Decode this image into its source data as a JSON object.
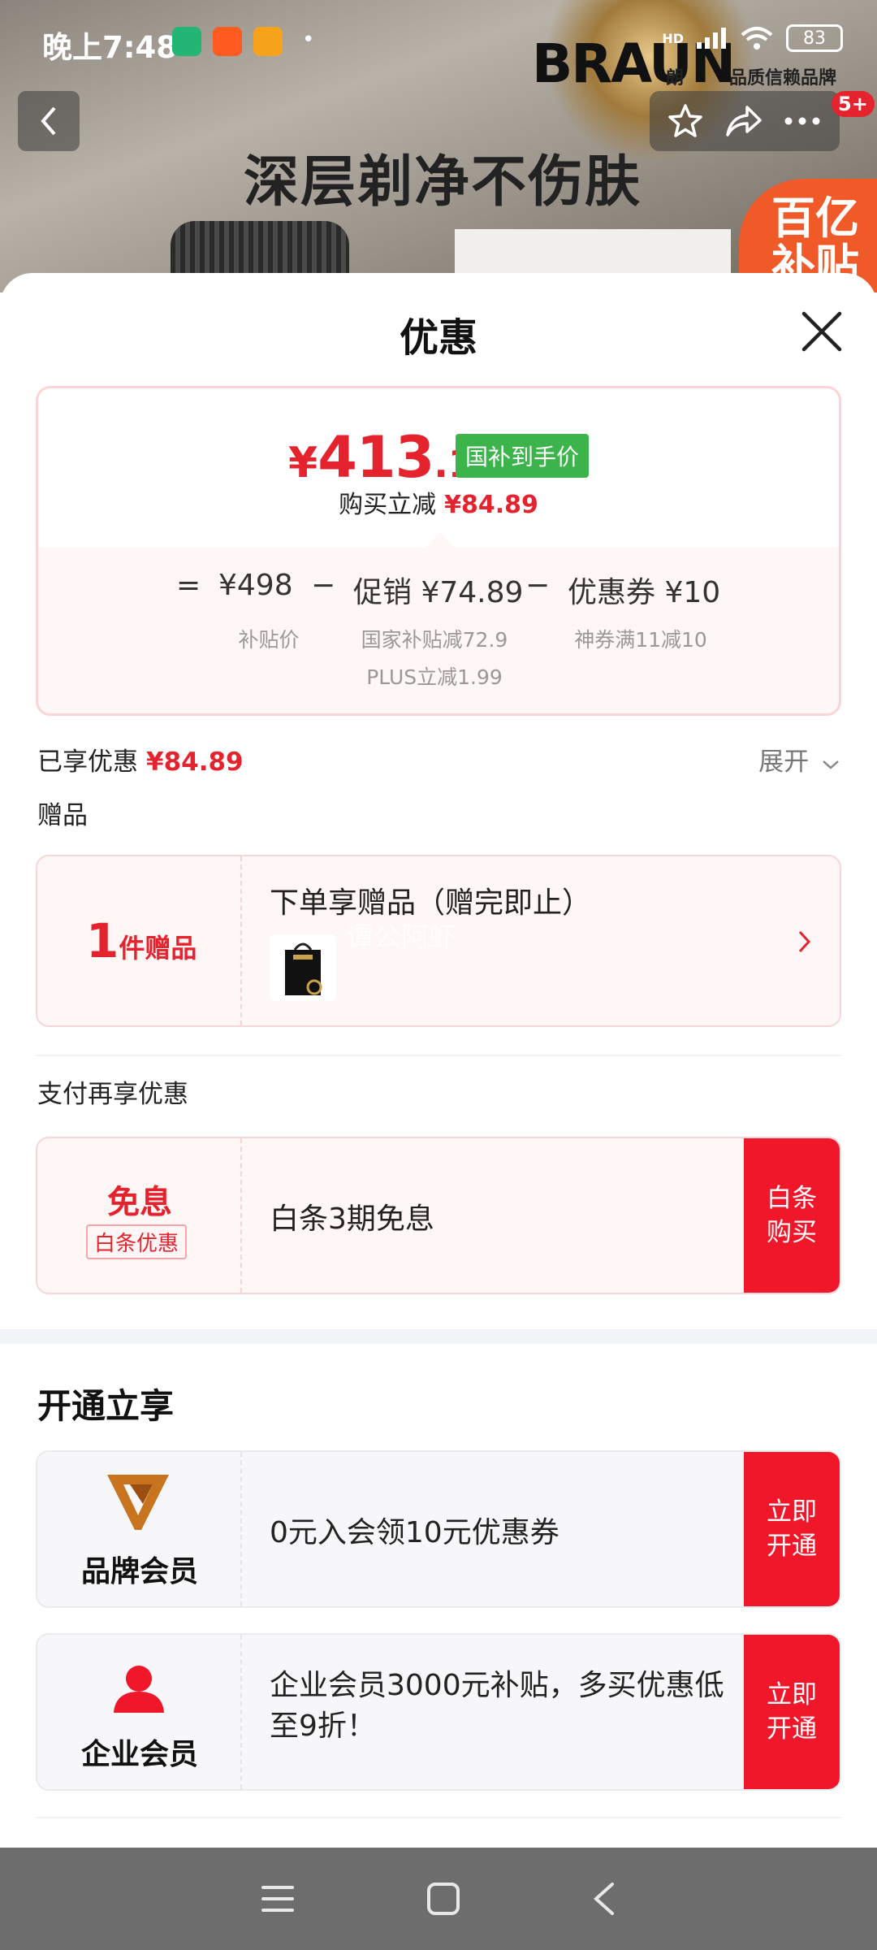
{
  "status_bar": {
    "time": "晚上7:48",
    "hd": "HD",
    "battery": "83"
  },
  "background": {
    "brand_logo": "BRAUN",
    "brand_sub": "朗",
    "brand_tag": "品质信赖品牌",
    "hero_text": "深层剃净不伤肤",
    "corner_badge": "百亿补贴",
    "notification_count": "5+"
  },
  "sheet": {
    "title": "优惠",
    "price": {
      "currency": "¥",
      "integer": "413",
      "decimal": ".11",
      "tag": "国补到手价",
      "buy_reduce_label": "购买立减",
      "buy_reduce_value": "¥84.89"
    },
    "formula": {
      "equals": "=",
      "base_value": "¥498",
      "base_label": "补贴价",
      "minus1": "−",
      "promo_value": "促销 ¥74.89",
      "promo_sub1": "国家补贴减72.9",
      "promo_sub2": "PLUS立减1.99",
      "minus2": "−",
      "coupon_value": "优惠券 ¥10",
      "coupon_label": "神券满11减10"
    },
    "enjoyed": {
      "label": "已享优惠",
      "value": "¥84.89",
      "expand": "展开"
    },
    "gifts": {
      "section_label": "赠品",
      "count": "1",
      "count_unit": "件赠品",
      "title": "下单享赠品（赠完即止）",
      "watermark": "谭公阿虾"
    },
    "pay": {
      "section_label": "支付再享优惠",
      "left_title": "免息",
      "left_tag": "白条优惠",
      "text": "白条3期免息",
      "button": "白条\n购买"
    },
    "membership": {
      "heading": "开通立享",
      "brand_label": "品牌会员",
      "brand_text": "0元入会领10元优惠券",
      "brand_button": "立即\n开通",
      "enterprise_label": "企业会员",
      "enterprise_text": "企业会员3000元补贴，多买优惠低至9折！",
      "enterprise_button": "立即\n开通"
    }
  },
  "colors": {
    "accent_red": "#e5232e",
    "button_red": "#f0172a",
    "green_tag": "#3cb34b",
    "brand_gold": "#c8741e"
  },
  "icons": [
    "back-icon",
    "star-icon",
    "share-icon",
    "more-icon",
    "close-icon",
    "chevron-down-icon",
    "chevron-right-icon",
    "brand-v-logo-icon",
    "person-icon",
    "menu-icon",
    "home-icon",
    "back-nav-icon"
  ]
}
